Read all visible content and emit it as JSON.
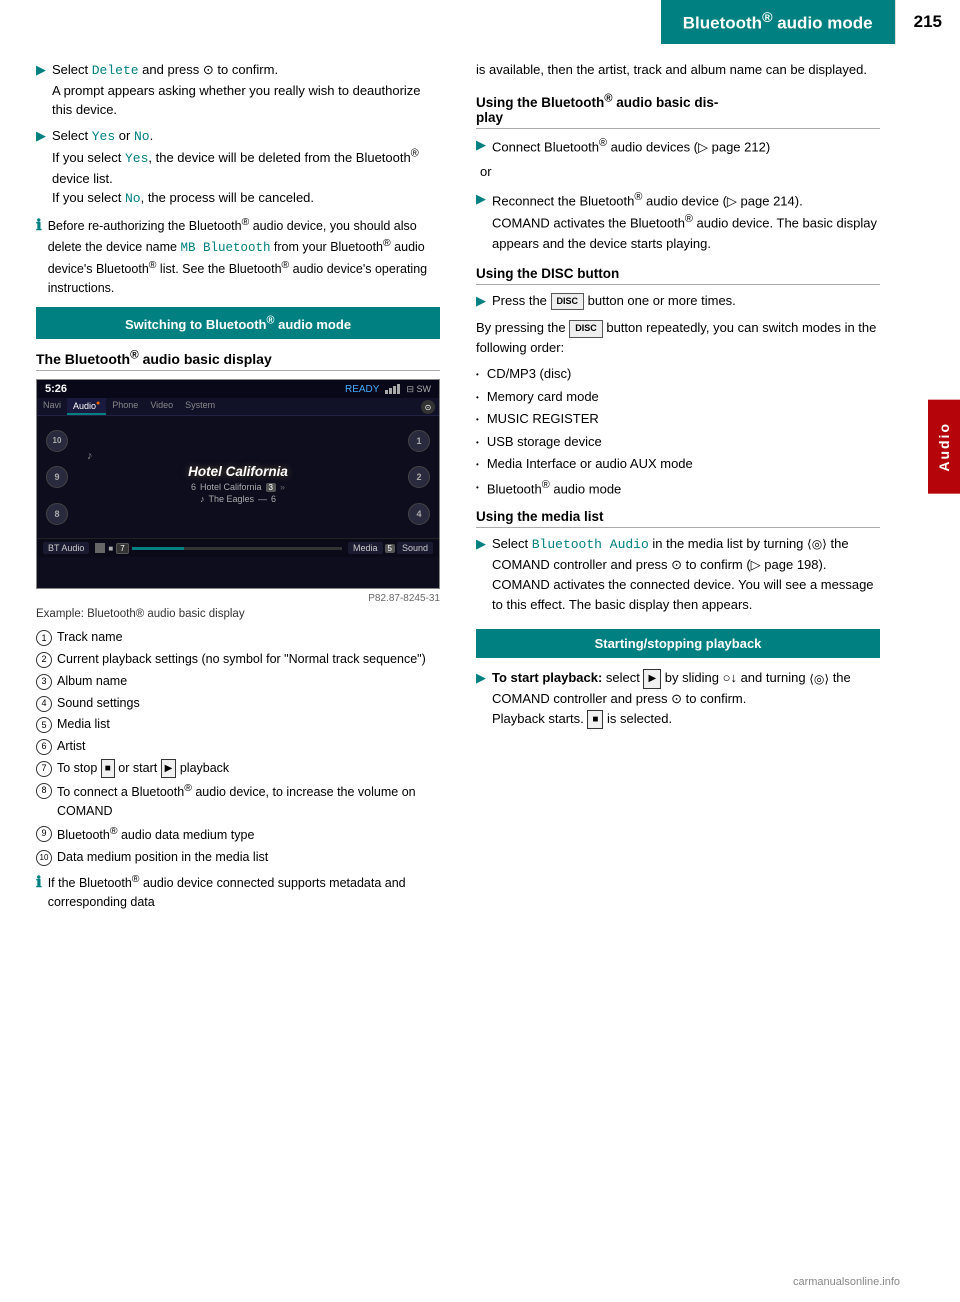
{
  "header": {
    "title": "Bluetooth",
    "title_sup": "®",
    "title_suffix": " audio mode",
    "page_number": "215"
  },
  "audio_tab": {
    "label": "Audio"
  },
  "left_col": {
    "bullets": [
      {
        "type": "arrow",
        "text_parts": [
          {
            "text": "Select ",
            "style": "normal"
          },
          {
            "text": "Delete",
            "style": "mono-teal"
          },
          {
            "text": " and press ",
            "style": "normal"
          },
          {
            "text": "⊙",
            "style": "normal"
          },
          {
            "text": " to confirm.",
            "style": "normal"
          }
        ],
        "continuation": "A prompt appears asking whether you really wish to deauthorize this device."
      },
      {
        "type": "arrow",
        "text_parts": [
          {
            "text": "Select ",
            "style": "normal"
          },
          {
            "text": "Yes",
            "style": "mono-teal"
          },
          {
            "text": " or ",
            "style": "normal"
          },
          {
            "text": "No",
            "style": "mono-teal"
          },
          {
            "text": ".",
            "style": "normal"
          }
        ],
        "continuation1": "If you select Yes, the device will be deleted from the Bluetooth® device list.",
        "continuation2": "If you select No, the process will be canceled."
      },
      {
        "type": "info",
        "text": "Before re-authorizing the Bluetooth® audio device, you should also delete the device name MB Bluetooth from your Bluetooth® audio device's Bluetooth® list. See the Bluetooth® audio device's operating instructions."
      }
    ],
    "section_box": "Switching to Bluetooth® audio mode",
    "subsection": "The Bluetooth® audio basic display",
    "display_image": {
      "time": "5:26",
      "ready": "READY",
      "nav_items": [
        "Navi",
        "Audio.",
        "Phone",
        "Video",
        "System"
      ],
      "track_name": "Hotel California",
      "artist": "The Eagles",
      "album": "Hotel California",
      "note": "♪",
      "bt_label": "BT Audio",
      "media_label": "Media",
      "sound_label": "Sound"
    },
    "image_ref": "P82.87-8245-31",
    "caption": "Example: Bluetooth® audio basic display",
    "num_items": [
      {
        "num": "1",
        "text": "Track name"
      },
      {
        "num": "2",
        "text": "Current playback settings (no symbol for \"Normal track sequence\")"
      },
      {
        "num": "3",
        "text": "Album name"
      },
      {
        "num": "4",
        "text": "Sound settings"
      },
      {
        "num": "5",
        "text": "Media list"
      },
      {
        "num": "6",
        "text": "Artist"
      },
      {
        "num": "7",
        "text": "To stop ■ or start ▶ playback"
      },
      {
        "num": "8",
        "text": "To connect a Bluetooth® audio device, to increase the volume on COMAND"
      },
      {
        "num": "9",
        "text": "Bluetooth® audio data medium type"
      },
      {
        "num": "10",
        "text": "Data medium position in the media list"
      }
    ],
    "info_note": "If the Bluetooth® audio device connected supports metadata and corresponding data"
  },
  "right_col": {
    "continuation_text": "is available, then the artist, track and album name can be displayed.",
    "subsections": [
      {
        "id": "basic-display",
        "title": "Using the Bluetooth® audio basic display",
        "bullets": [
          {
            "type": "arrow",
            "text": "Connect Bluetooth® audio devices (▷ page 212)"
          }
        ],
        "or_text": "or",
        "bullets2": [
          {
            "type": "arrow",
            "text": "Reconnect the Bluetooth® audio device (▷ page 214). COMAND activates the Bluetooth® audio device. The basic display appears and the device starts playing."
          }
        ]
      },
      {
        "id": "disc-button",
        "title": "Using the DISC button",
        "bullets": [
          {
            "type": "arrow",
            "text": "Press the DISC button one or more times."
          }
        ],
        "para": "By pressing the DISC button repeatedly, you can switch modes in the following order:",
        "dot_list": [
          "CD/MP3 (disc)",
          "Memory card mode",
          "MUSIC REGISTER",
          "USB storage device",
          "Media Interface or audio AUX mode",
          "Bluetooth® audio mode"
        ]
      },
      {
        "id": "media-list",
        "title": "Using the media list",
        "bullets": [
          {
            "type": "arrow",
            "text_parts": [
              {
                "text": "Select ",
                "style": "normal"
              },
              {
                "text": "Bluetooth Audio",
                "style": "mono-teal"
              },
              {
                "text": " in the media list by turning ",
                "style": "normal"
              },
              {
                "text": "⟨◎⟩",
                "style": "ctrl"
              },
              {
                "text": " the COMAND controller and press ",
                "style": "normal"
              },
              {
                "text": "⊙",
                "style": "normal"
              },
              {
                "text": " to confirm (▷ page 198). COMAND activates the connected device. You will see a message to this effect. The basic display then appears.",
                "style": "normal"
              }
            ]
          }
        ]
      }
    ],
    "section_box2": "Starting/stopping playback",
    "playback_bullets": [
      {
        "type": "arrow",
        "label": "To start playback:",
        "text": "select ▶ by sliding ○↓ and turning ⟨◎⟩ the COMAND controller and press ⊙ to confirm. Playback starts. ■ is selected."
      }
    ]
  }
}
